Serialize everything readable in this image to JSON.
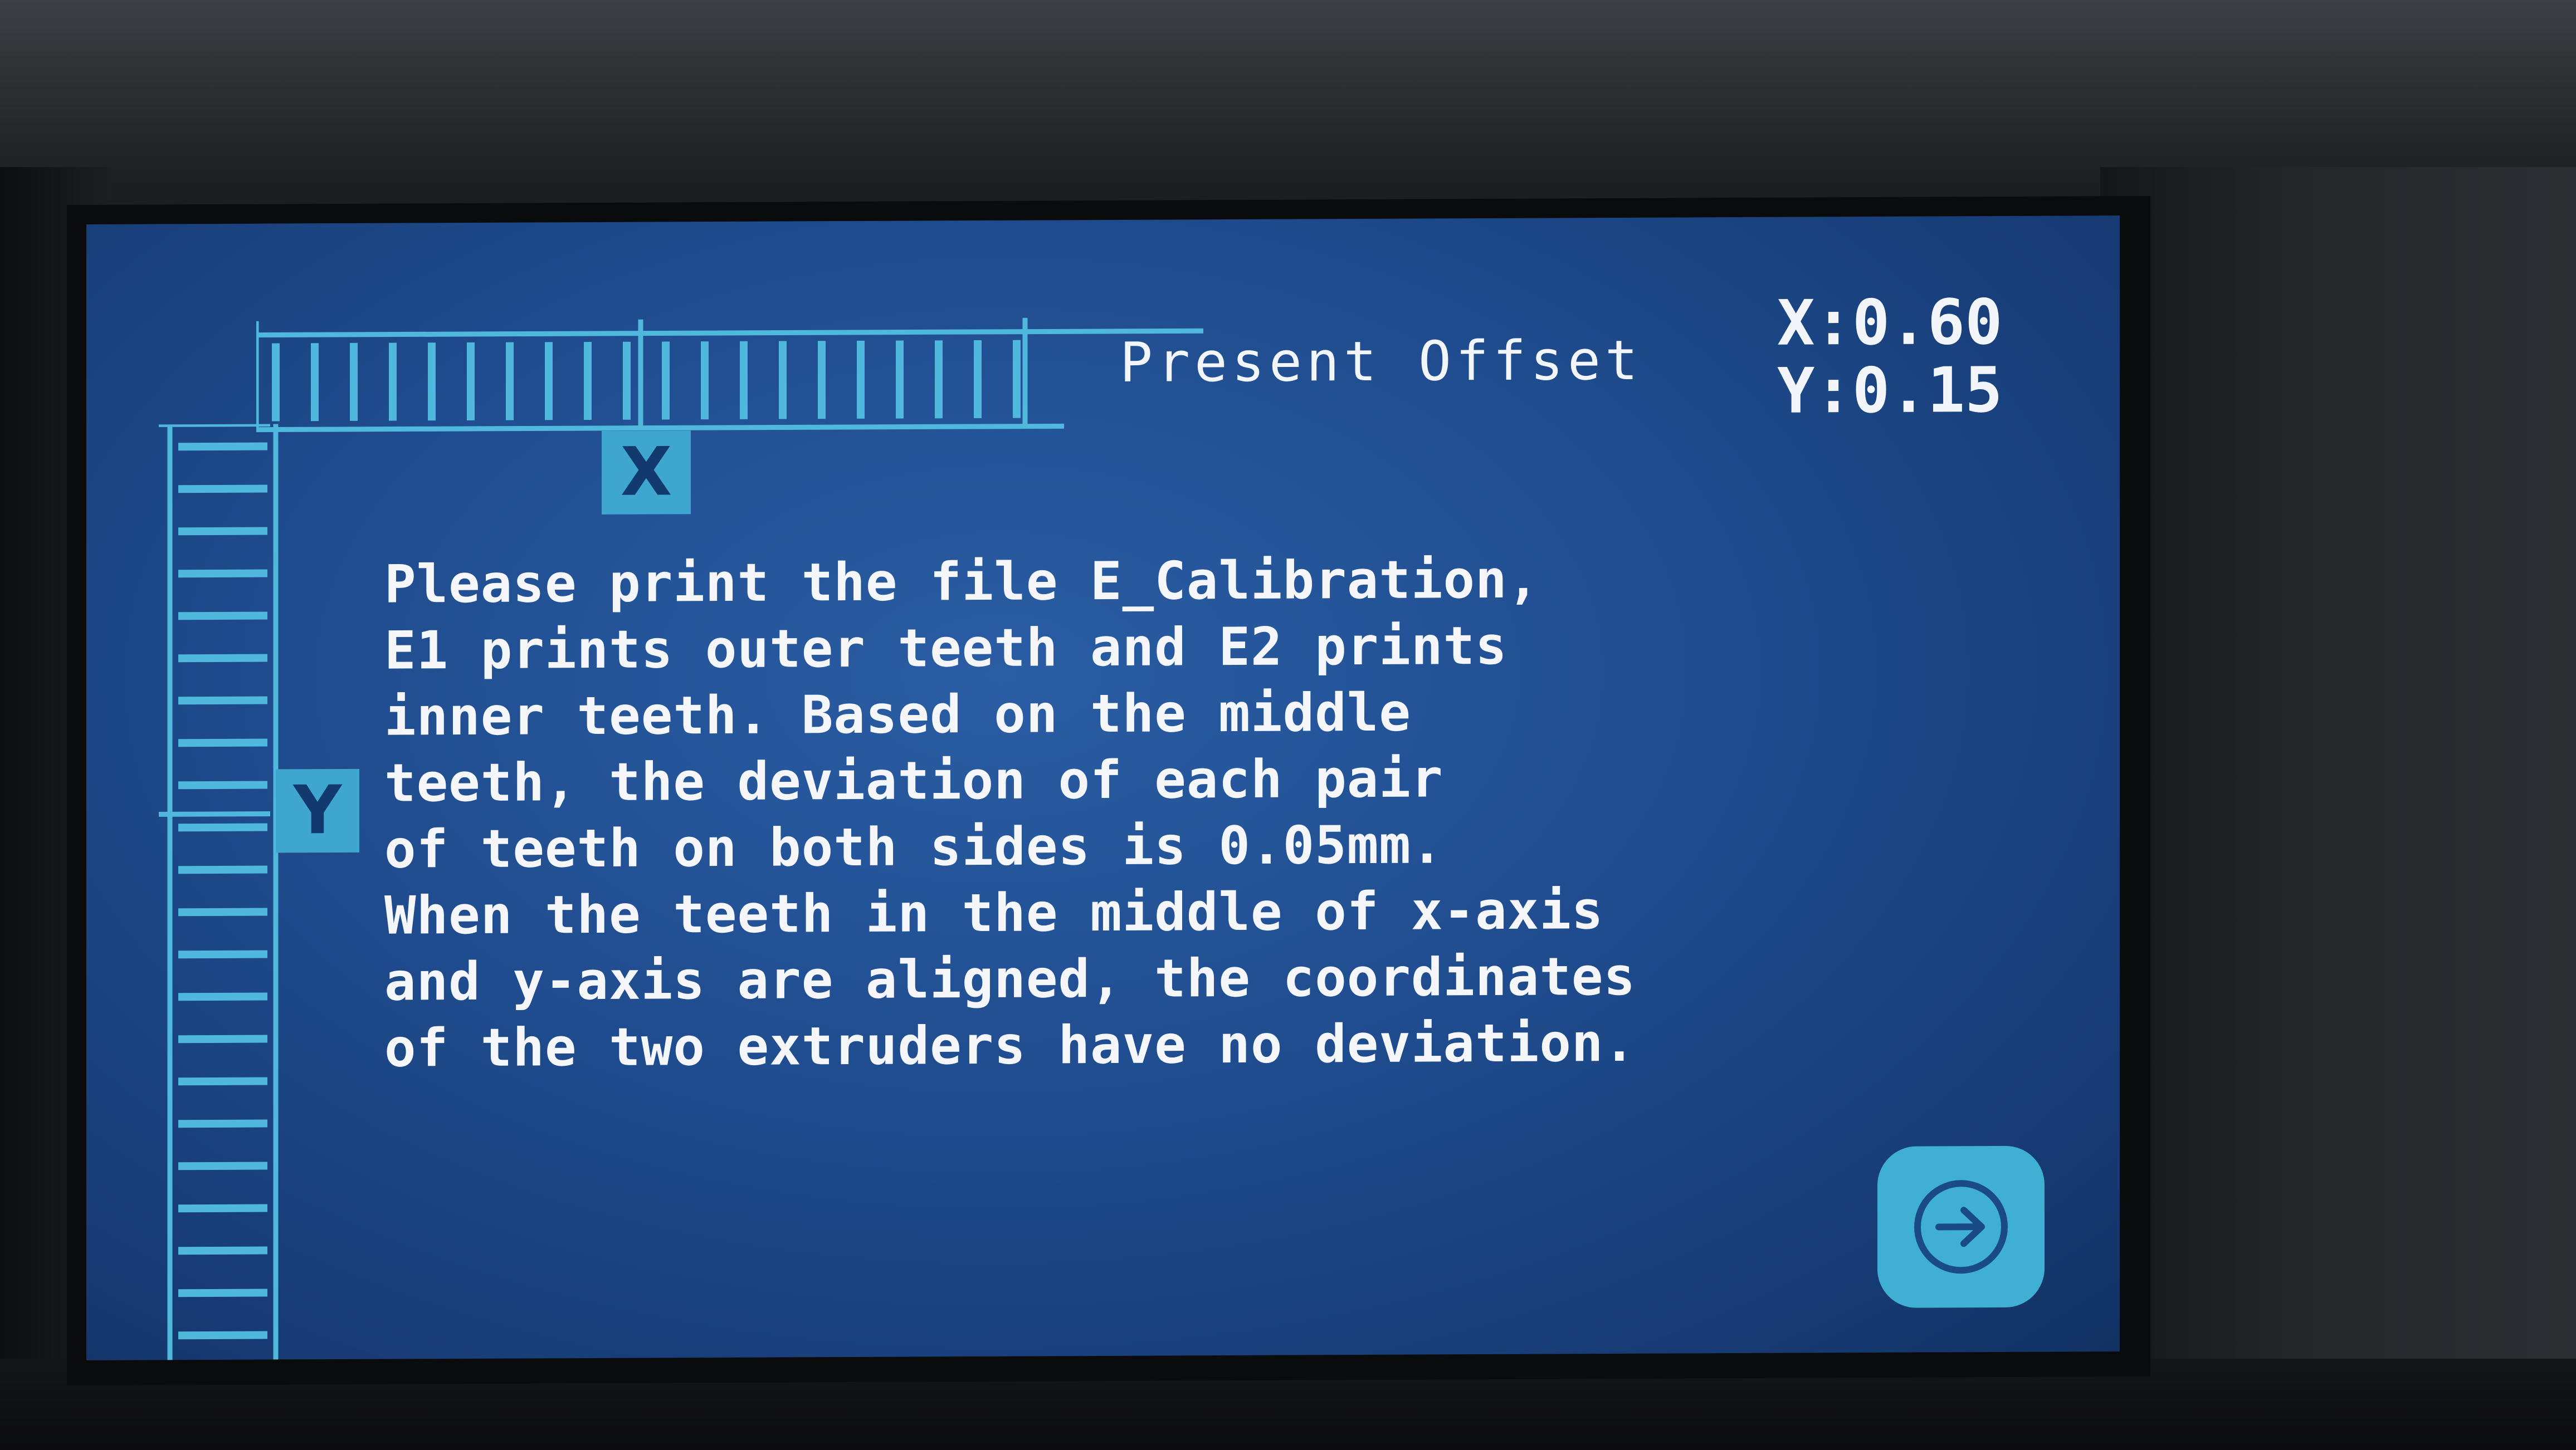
{
  "screen": {
    "title": "Present Offset",
    "offset_x": "X:0.60",
    "offset_y": "Y:0.15",
    "x_axis_label": "X",
    "y_axis_label": "Y",
    "message_lines": [
      "Please print the file E_Calibration,",
      "E1 prints outer teeth and E2 prints",
      "inner teeth. Based on the middle",
      "teeth, the deviation of each pair",
      "of teeth on both sides is 0.05mm.",
      "When the teeth in the middle of x-axis",
      "and y-axis are aligned, the coordinates",
      "of the two extruders have no deviation."
    ],
    "next_button_icon": "arrow-right-circle-icon"
  },
  "colors": {
    "screen_background": "#1f4c8e",
    "accent": "#3fb0d4",
    "text": "#f4f6fa",
    "device_bezel": "#1b1d21"
  }
}
